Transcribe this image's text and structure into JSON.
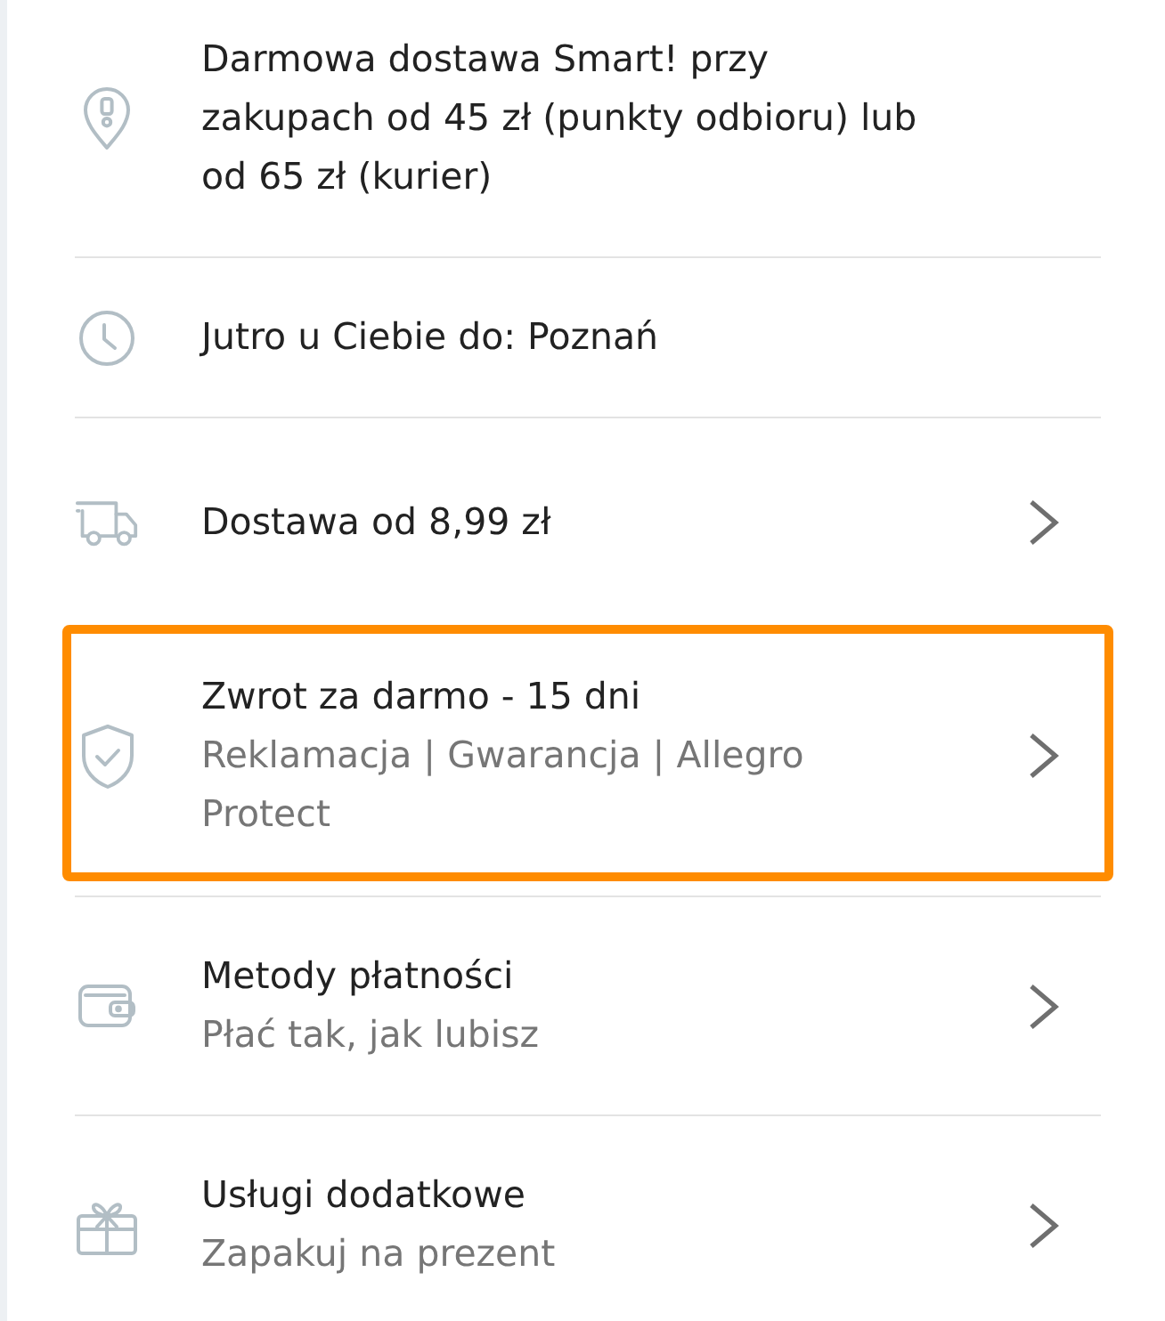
{
  "items": [
    {
      "kind": "info",
      "title": "Darmowa dostawa Smart! przy zakupach od 45 zł (punkty odbioru) lub od 65 zł (kurier)",
      "selected": false
    },
    {
      "kind": "info",
      "title": "Jutro u Ciebie do: Poznań",
      "selected": false
    },
    {
      "kind": "link",
      "title": "Dostawa od 8,99 zł",
      "selected": false
    },
    {
      "kind": "link",
      "title": "Zwrot za darmo - 15 dni",
      "subtitle": "Reklamacja | Gwarancja | Allegro Protect",
      "selected": true
    },
    {
      "kind": "link",
      "title": "Metody płatności",
      "subtitle": "Płać tak, jak lubisz",
      "selected": false
    },
    {
      "kind": "link",
      "title": "Usługi dodatkowe",
      "subtitle": "Zapakuj na prezent",
      "selected": false
    }
  ]
}
